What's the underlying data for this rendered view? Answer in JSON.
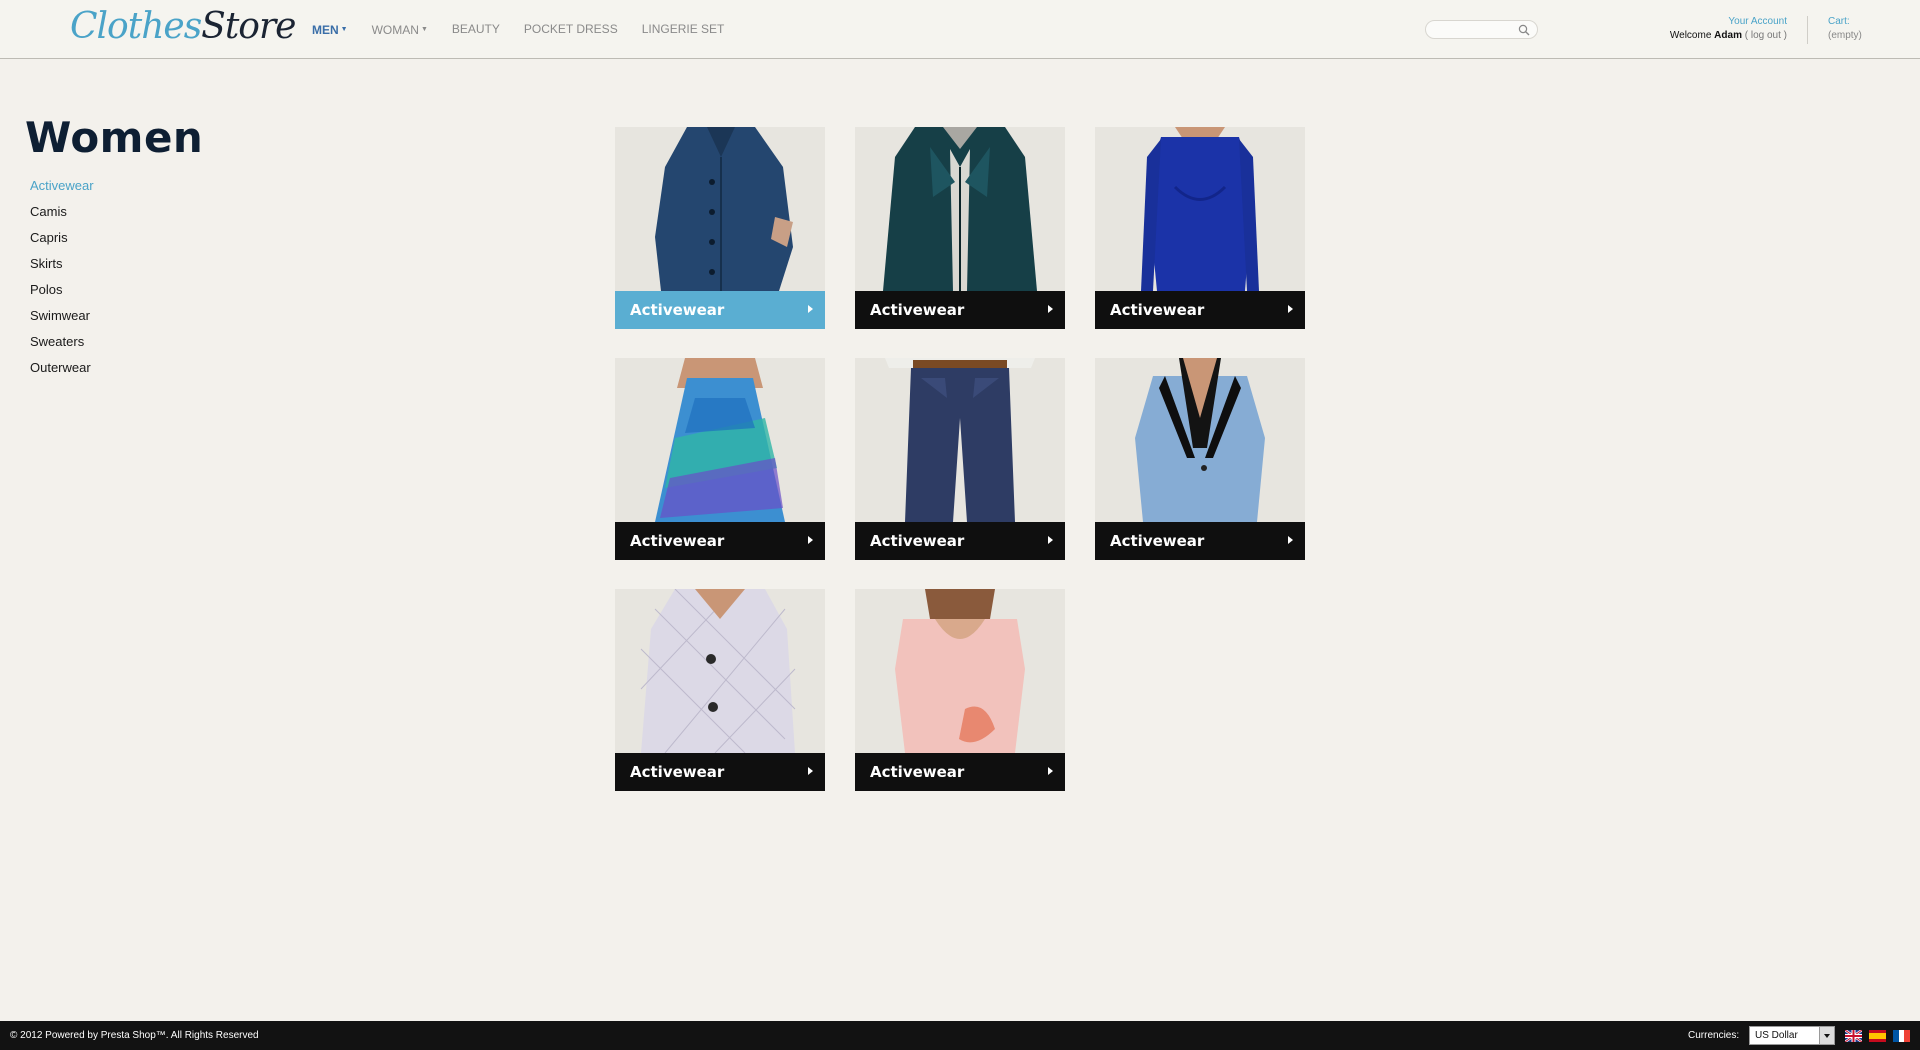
{
  "header": {
    "logo": {
      "part1": "Clothes",
      "part2": "Store"
    },
    "nav": [
      {
        "label": "MEN",
        "active": true,
        "dropdown": true
      },
      {
        "label": "WOMAN",
        "active": false,
        "dropdown": true
      },
      {
        "label": "BEAUTY",
        "active": false,
        "dropdown": false
      },
      {
        "label": "POCKET DRESS",
        "active": false,
        "dropdown": false
      },
      {
        "label": "LINGERIE SET",
        "active": false,
        "dropdown": false
      }
    ],
    "search": {
      "placeholder": "",
      "icon": "search-icon"
    },
    "account": {
      "link": "Your Account",
      "welcome": "Welcome",
      "name": "Adam",
      "logout": "( log out )"
    },
    "cart": {
      "label": "Cart:",
      "status": "(empty)"
    }
  },
  "sidebar": {
    "title": "Women",
    "categories": [
      {
        "label": "Activewear",
        "active": true
      },
      {
        "label": "Camis",
        "active": false
      },
      {
        "label": "Capris",
        "active": false
      },
      {
        "label": "Skirts",
        "active": false
      },
      {
        "label": "Polos",
        "active": false
      },
      {
        "label": "Swimwear",
        "active": false
      },
      {
        "label": "Sweaters",
        "active": false
      },
      {
        "label": "Outerwear",
        "active": false
      }
    ]
  },
  "products": [
    {
      "label": "Activewear",
      "highlighted": true,
      "image": "navy-coat"
    },
    {
      "label": "Activewear",
      "highlighted": false,
      "image": "teal-leather-jacket"
    },
    {
      "label": "Activewear",
      "highlighted": false,
      "image": "blue-dress"
    },
    {
      "label": "Activewear",
      "highlighted": false,
      "image": "printed-maxi-dress"
    },
    {
      "label": "Activewear",
      "highlighted": false,
      "image": "denim-jeans"
    },
    {
      "label": "Activewear",
      "highlighted": false,
      "image": "light-blue-blazer"
    },
    {
      "label": "Activewear",
      "highlighted": false,
      "image": "quilted-white-jacket"
    },
    {
      "label": "Activewear",
      "highlighted": false,
      "image": "pink-tee"
    }
  ],
  "footer": {
    "copyright": "© 2012 Powered by Presta Shop™.  All Rights Reserved",
    "currency_label": "Currencies:",
    "currency_selected": "US Dollar",
    "languages": [
      "english-flag-icon",
      "spanish-flag-icon",
      "french-flag-icon"
    ]
  },
  "colors": {
    "accent": "#4aa3c8",
    "dark": "#0e1f33",
    "bar": "#0f0f0f",
    "bar_highlight": "#5aaed2"
  }
}
